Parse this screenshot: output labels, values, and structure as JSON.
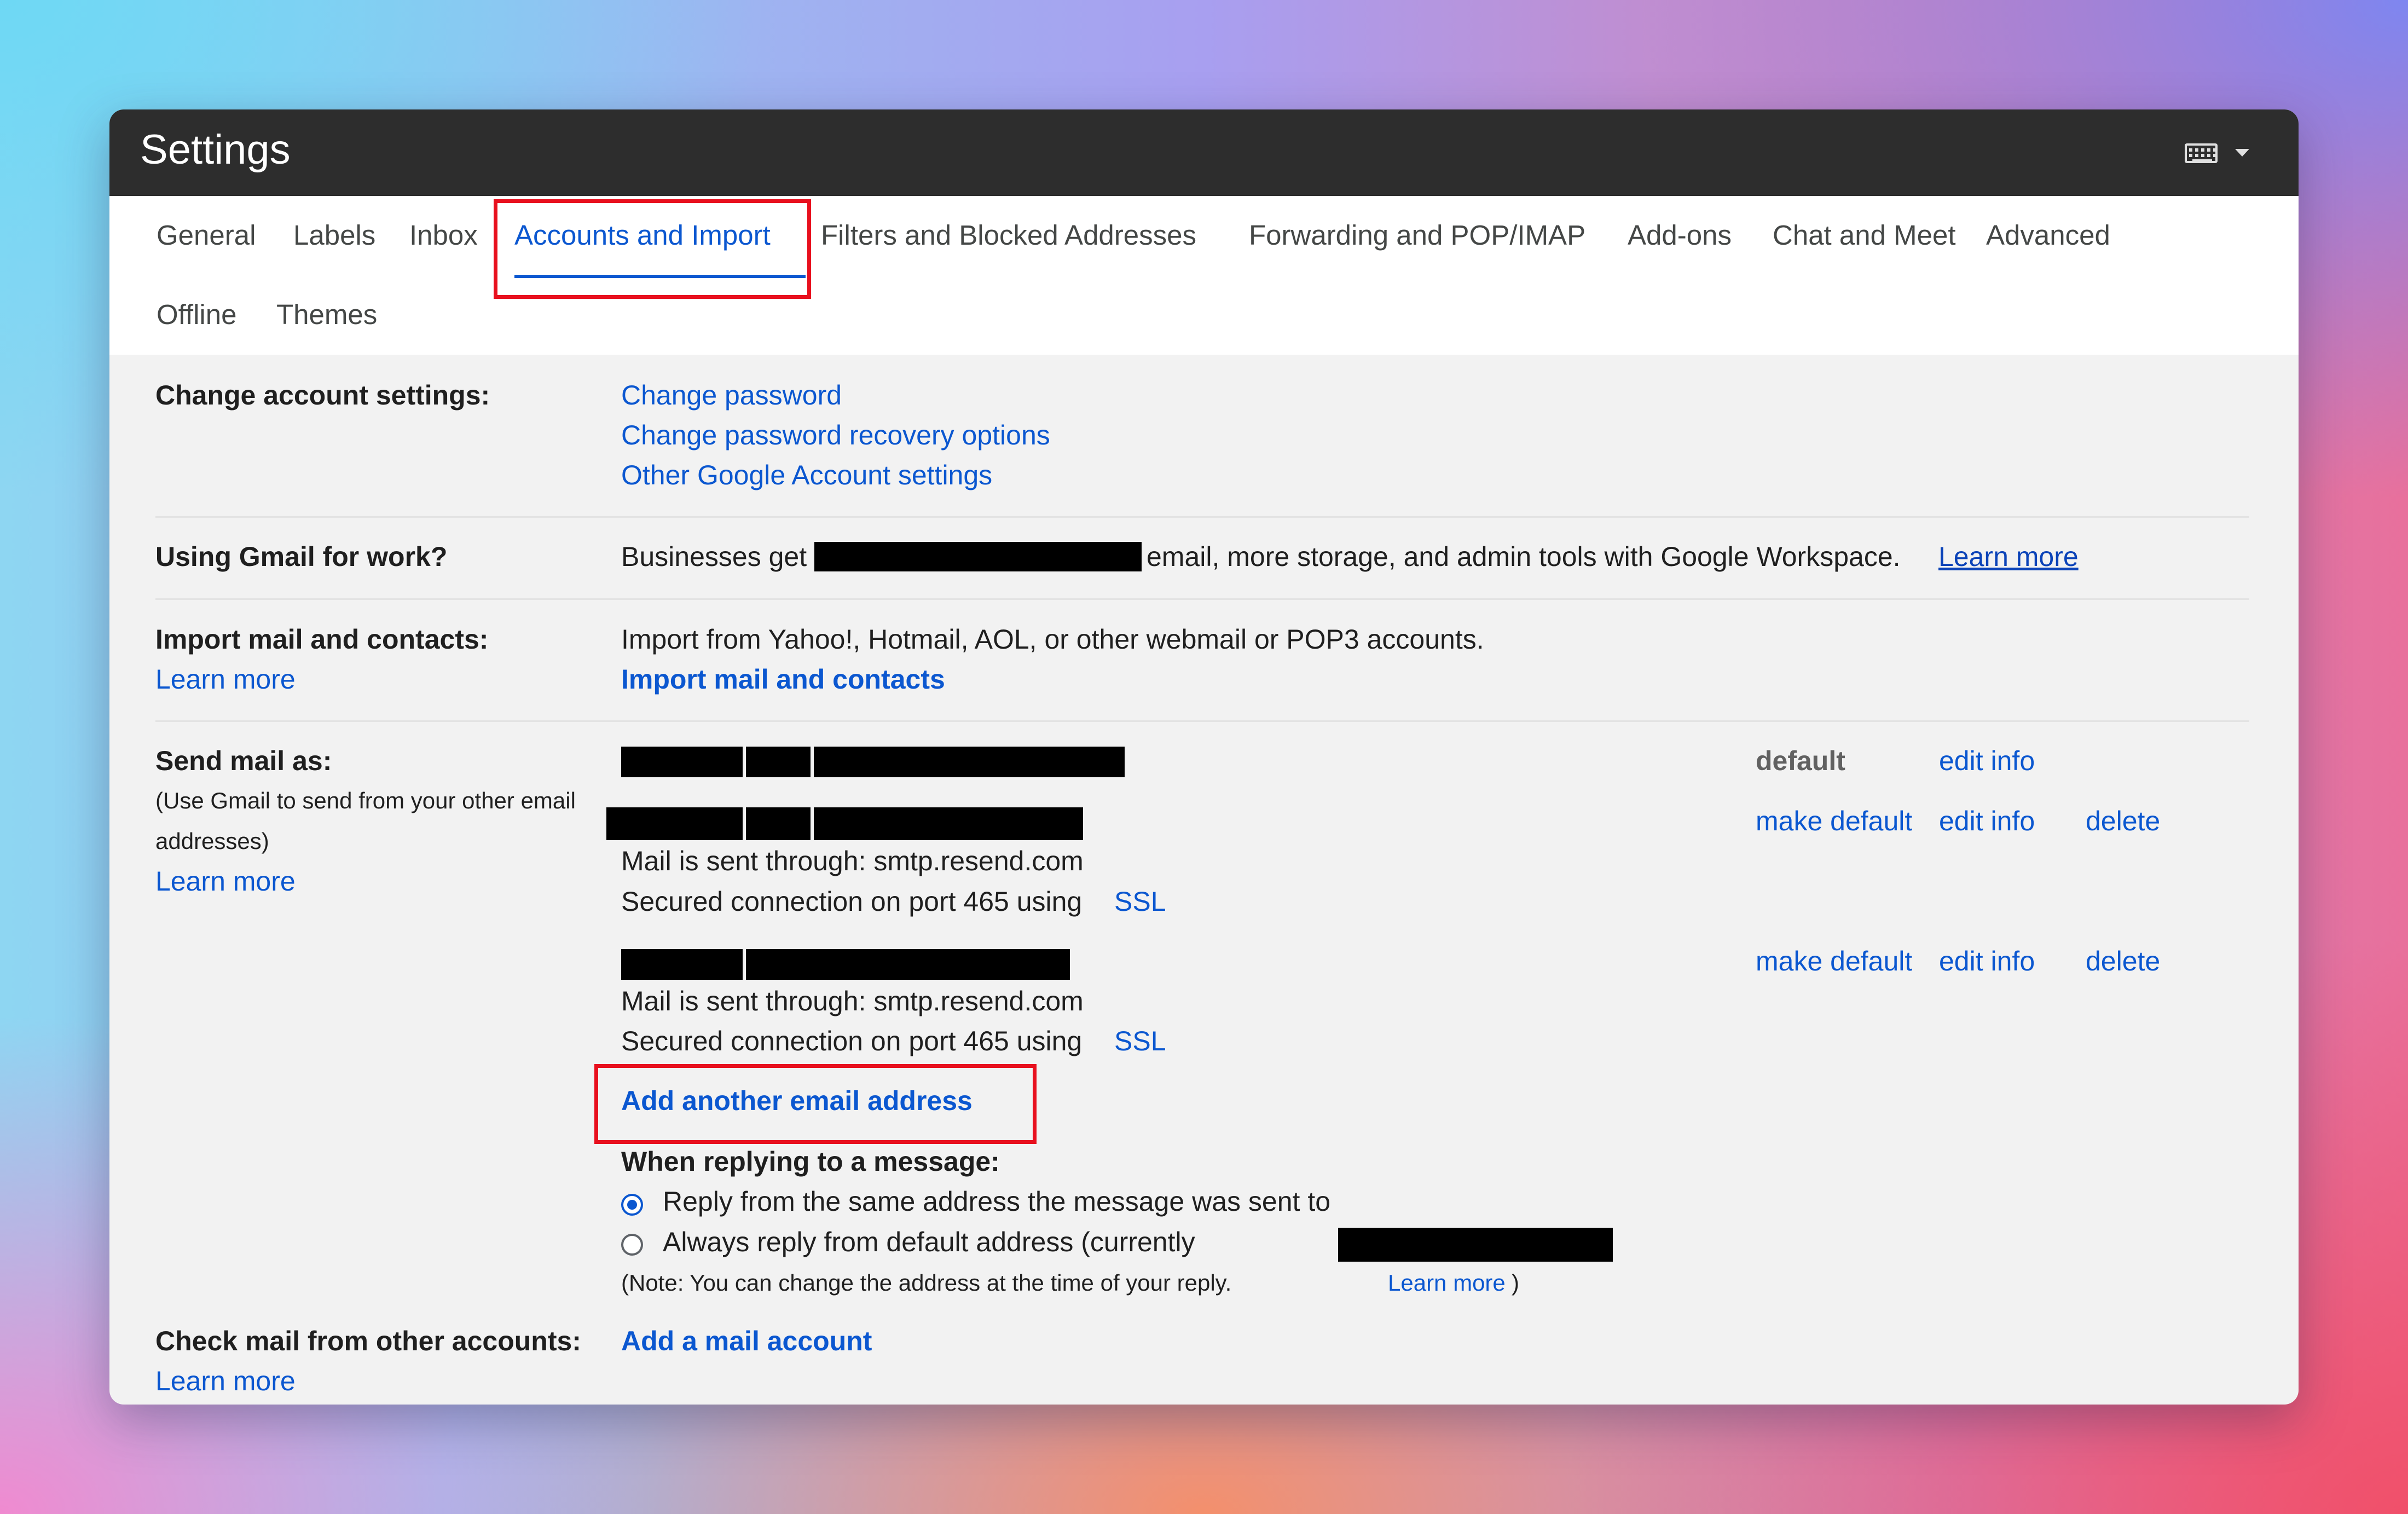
{
  "window": {
    "title": "Settings",
    "input_tools_icon": "keyboard-icon"
  },
  "tabs": {
    "general": "General",
    "labels": "Labels",
    "inbox": "Inbox",
    "accounts": "Accounts and Import",
    "filters": "Filters and Blocked Addresses",
    "forwarding": "Forwarding and POP/IMAP",
    "addons": "Add-ons",
    "chat": "Chat and Meet",
    "advanced": "Advanced",
    "offline": "Offline",
    "themes": "Themes",
    "active": "Accounts and Import"
  },
  "change_account": {
    "label": "Change account settings:",
    "links": [
      "Change password",
      "Change password recovery options",
      "Other Google Account settings"
    ]
  },
  "gmail_work": {
    "label": "Using Gmail for work?",
    "text_before": "Businesses get",
    "text_after": "email, more storage, and admin tools with Google Workspace.",
    "learn_more": "Learn more"
  },
  "import_mail": {
    "label": "Import mail and contacts:",
    "learn_more": "Learn more",
    "description": "Import from Yahoo!, Hotmail, AOL, or other webmail or POP3 accounts.",
    "action": "Import mail and contacts"
  },
  "send_mail": {
    "label": "Send mail as:",
    "note_line1": "(Use Gmail to send from your other email",
    "note_line2": "addresses)",
    "learn_more": "Learn more",
    "accounts": [
      {
        "status": "default",
        "edit": "edit info"
      },
      {
        "make_default": "make default",
        "edit": "edit info",
        "delete": "delete",
        "sent_through": "Mail is sent through: smtp.resend.com",
        "secured": "Secured connection on port 465 using",
        "ssl": "SSL"
      },
      {
        "make_default": "make default",
        "edit": "edit info",
        "delete": "delete",
        "sent_through": "Mail is sent through: smtp.resend.com",
        "secured": "Secured connection on port 465 using",
        "ssl": "SSL"
      }
    ],
    "add_address": "Add another email address",
    "reply_heading": "When replying to a message:",
    "reply_options": [
      {
        "label": "Reply from the same address the message was sent to",
        "selected": true
      },
      {
        "label": "Always reply from default address (currently",
        "selected": false
      }
    ],
    "reply_note": "(Note: You can change the address at the time of your reply.",
    "reply_note_link": "Learn more",
    "reply_note_end": ")"
  },
  "check_mail": {
    "label": "Check mail from other accounts:",
    "action": "Add a mail account",
    "learn_more": "Learn more"
  },
  "colors": {
    "titlebar": "#2d2d2d",
    "link": "#0b57d0",
    "highlight": "#e8101e",
    "redaction": "#000000"
  }
}
